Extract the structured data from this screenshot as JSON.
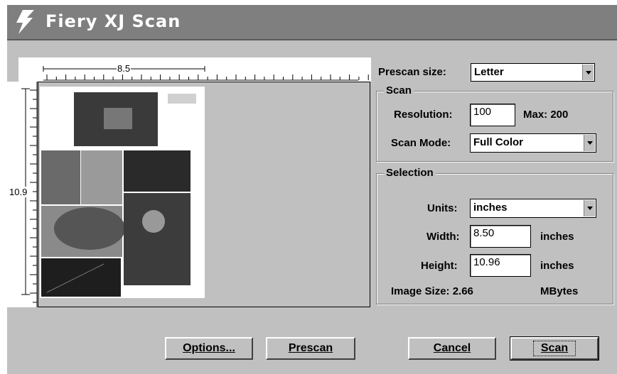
{
  "window": {
    "title": "Fiery XJ Scan"
  },
  "icons": {
    "title": "lightning-bolt-icon",
    "dropdown": "dropdown-arrow-icon"
  },
  "ruler": {
    "width_label": "8.5",
    "height_label": "10.9"
  },
  "prescan_size": {
    "label": "Prescan size:",
    "value": "Letter"
  },
  "scan_group": {
    "title": "Scan",
    "resolution_label": "Resolution:",
    "resolution_value": "100",
    "max_text": "Max: 200",
    "mode_label": "Scan Mode:",
    "mode_value": "Full Color"
  },
  "selection_group": {
    "title": "Selection",
    "units_label": "Units:",
    "units_value": "inches",
    "width_label": "Width:",
    "width_value": "8.50",
    "width_unit": "inches",
    "height_label": "Height:",
    "height_value": "10.96",
    "height_unit": "inches",
    "image_size_label": "Image Size: 2.66",
    "image_size_unit": "MBytes"
  },
  "buttons": {
    "options": "Options...",
    "prescan": "Prescan",
    "cancel": "Cancel",
    "scan": "Scan"
  }
}
